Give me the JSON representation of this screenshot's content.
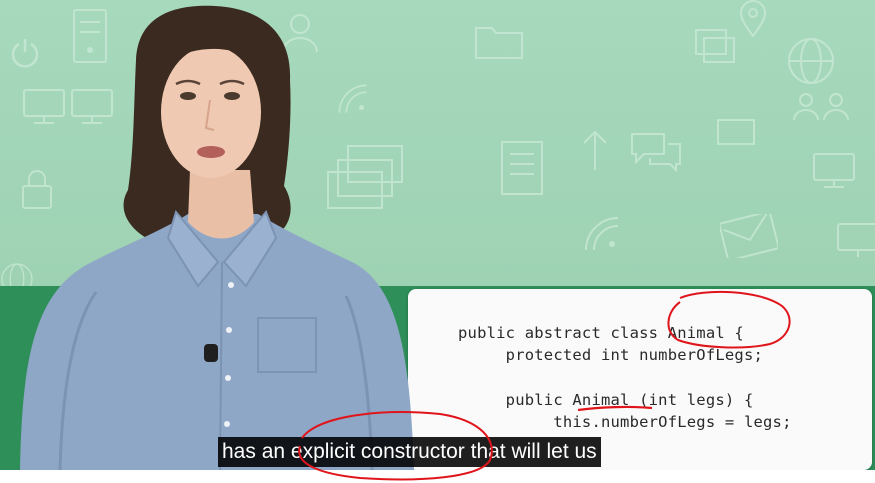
{
  "video": {
    "code_lines": [
      "public abstract class Animal {",
      "     protected int numberOfLegs;",
      "",
      "     public Animal (int legs) {",
      "          this.numberOfLegs = legs;"
    ],
    "caption": "has an explicit constructor that will let us",
    "colors": {
      "background": "#a7d9bd",
      "panel": "#2e8f59",
      "card": "#fafafa",
      "annotation": "#e0151b"
    },
    "background_icons": [
      "monitor-icon",
      "lock-icon",
      "power-icon",
      "server-icon",
      "user-icon",
      "folder-icon",
      "location-pin-icon",
      "globe-icon",
      "people-icon",
      "chat-icon",
      "envelope-icon",
      "wifi-icon",
      "document-icon",
      "arrow-up-icon",
      "window-icon"
    ]
  }
}
